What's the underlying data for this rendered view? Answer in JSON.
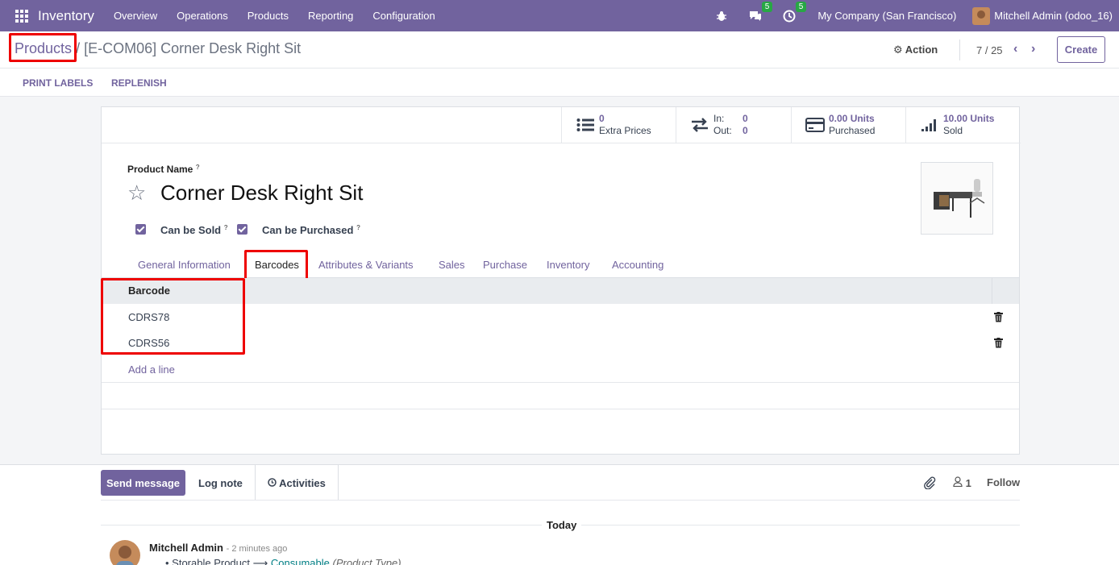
{
  "nav": {
    "app_name": "Inventory",
    "menus": [
      "Overview",
      "Operations",
      "Products",
      "Reporting",
      "Configuration"
    ],
    "messages_count": "5",
    "activities_count": "5",
    "company": "My Company (San Francisco)",
    "user": "Mitchell Admin (odoo_16)"
  },
  "breadcrumb": {
    "parent": "Products",
    "separator": "/",
    "current": "[E-COM06] Corner Desk Right Sit"
  },
  "toolbar": {
    "action_label": "Action",
    "pager": "7 / 25",
    "create_label": "Create"
  },
  "statusbar": {
    "print_labels": "PRINT LABELS",
    "replenish": "REPLENISH"
  },
  "smart_buttons": {
    "extra_prices_value": "0",
    "extra_prices_label": "Extra Prices",
    "in_label": "In:",
    "in_value": "0",
    "out_label": "Out:",
    "out_value": "0",
    "purchased_value": "0.00 Units",
    "purchased_label": "Purchased",
    "sold_value": "10.00 Units",
    "sold_label": "Sold"
  },
  "product": {
    "name_label": "Product Name",
    "help_mark": "?",
    "name": "Corner Desk Right Sit",
    "can_be_sold_label": "Can be Sold",
    "can_be_purchased_label": "Can be Purchased"
  },
  "tabs": [
    "General Information",
    "Barcodes",
    "Attributes & Variants",
    "Sales",
    "Purchase",
    "Inventory",
    "Accounting"
  ],
  "barcodes": {
    "column": "Barcode",
    "rows": [
      "CDRS78",
      "CDRS56"
    ],
    "add_line": "Add a line"
  },
  "chatter": {
    "send_message": "Send message",
    "log_note": "Log note",
    "activities": "Activities",
    "followers_count": "1",
    "follow": "Follow",
    "today": "Today",
    "author": "Mitchell Admin",
    "time": "- 2 minutes ago",
    "change_old": "Storable Product",
    "change_new": "Consumable",
    "change_field": "(Product Type)"
  },
  "colors": {
    "brand": "#71639e",
    "highlight": "#e00000",
    "badge": "#28a745"
  }
}
